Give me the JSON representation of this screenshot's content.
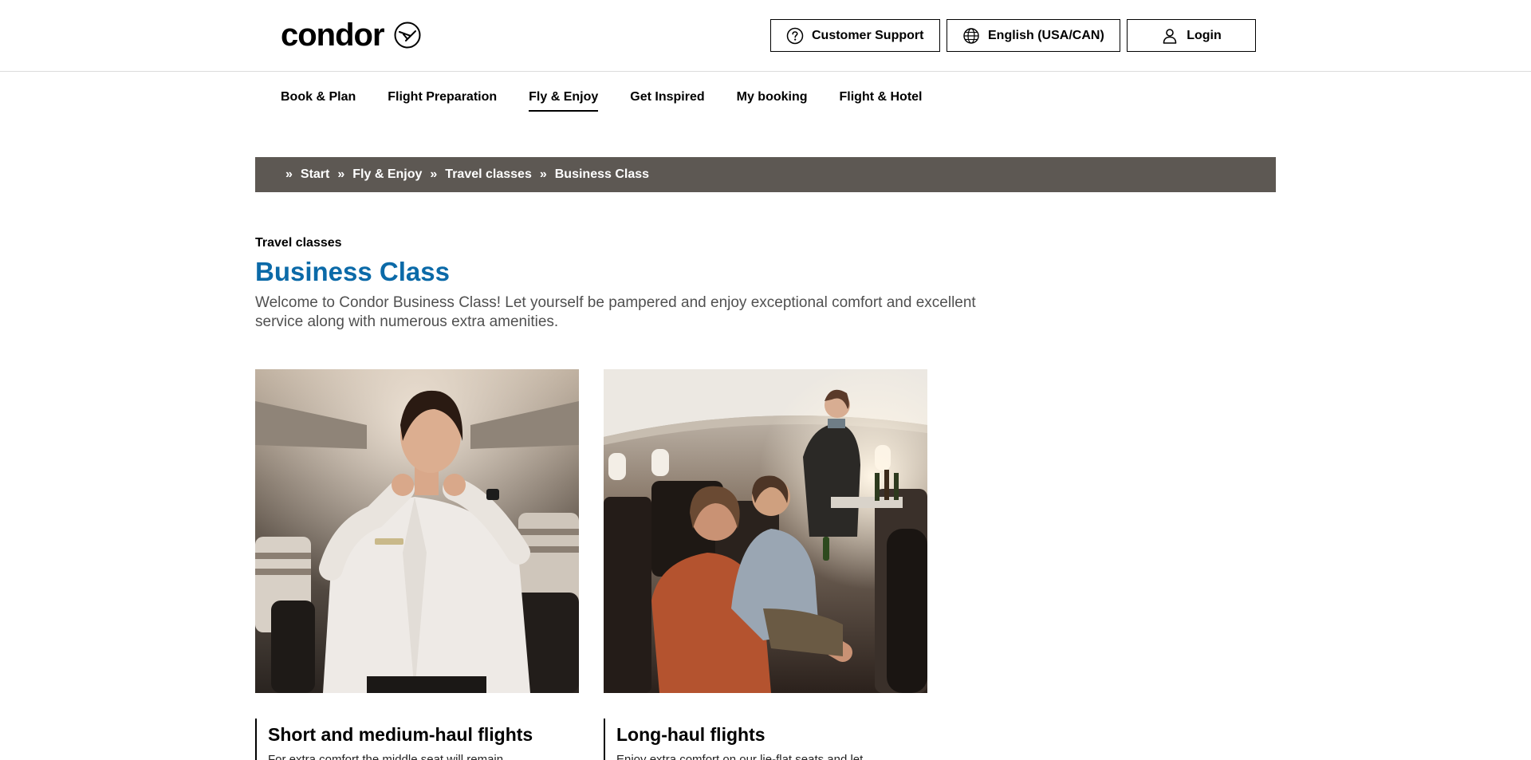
{
  "header": {
    "logo_text": "condor",
    "buttons": {
      "support": "Customer Support",
      "language": "English (USA/CAN)",
      "login": "Login"
    }
  },
  "nav": {
    "items": [
      {
        "label": "Book & Plan"
      },
      {
        "label": "Flight Preparation"
      },
      {
        "label": "Fly & Enjoy",
        "active": true
      },
      {
        "label": "Get Inspired"
      },
      {
        "label": "My booking"
      },
      {
        "label": "Flight & Hotel"
      }
    ]
  },
  "breadcrumb": {
    "separator": "»",
    "items": [
      "Start",
      "Fly & Enjoy",
      "Travel classes",
      "Business Class"
    ]
  },
  "intro": {
    "kicker": "Travel classes",
    "title": "Business Class",
    "lead": "Welcome to Condor Business Class! Let yourself be pampered and enjoy exceptional comfort and excellent service along with numerous extra amenities."
  },
  "cards": [
    {
      "title": "Short and medium-haul flights",
      "text": "For extra comfort the middle seat will remain"
    },
    {
      "title": "Long-haul flights",
      "text": "Enjoy extra comfort on our lie-flat seats and let"
    }
  ],
  "colors": {
    "title_blue": "#0b6aa8",
    "breadcrumb_bg": "#5d5853",
    "lead_text": "#505050"
  },
  "icons": {
    "logo_mark": "condor-bird-circle-icon",
    "support": "question-circle-icon",
    "language": "globe-icon",
    "login": "user-icon"
  }
}
